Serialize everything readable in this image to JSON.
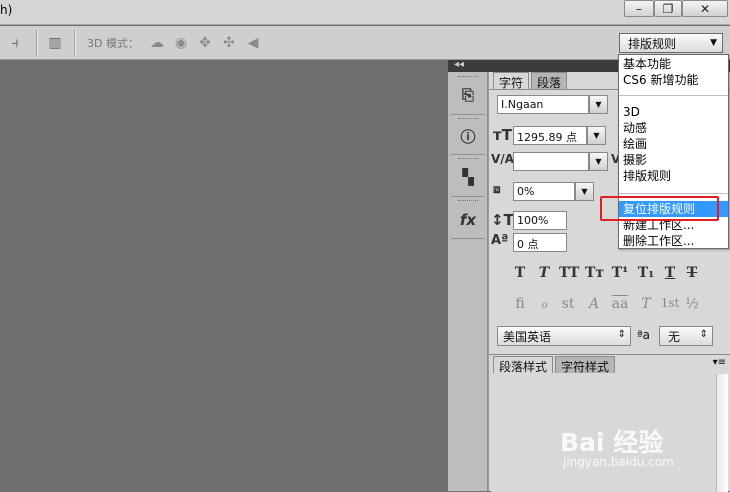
{
  "topbar": {
    "menu_fragment": "h)"
  },
  "window_buttons": {
    "minimize": "–",
    "restore": "❐",
    "close": "✕"
  },
  "options_bar": {
    "mode_label": "3D 模式："
  },
  "workspace": {
    "selected": "排版规则",
    "menu": {
      "group1": [
        "基本功能",
        "CS6 新增功能"
      ],
      "group2": [
        "3D",
        "动感",
        "绘画",
        "摄影",
        "排版规则"
      ],
      "group3": [
        "复位排版规则",
        "新建工作区...",
        "删除工作区..."
      ],
      "highlighted": "复位排版规则"
    }
  },
  "character_panel": {
    "tabs": [
      "字符",
      "段落"
    ],
    "font_family": "I.Ngaan",
    "font_size": "1295.89 点",
    "tracking": "0%",
    "vertical_scale": "100%",
    "baseline_shift": "0 点",
    "language": "美国英语",
    "antialias_label": "ªa",
    "antialias": "无",
    "style_buttons": [
      "T",
      "T",
      "TT",
      "Tт",
      "T¹",
      "T₁",
      "T",
      "T"
    ],
    "opentype_buttons": [
      "fi",
      "ℴ",
      "st",
      "A",
      "aa",
      "T",
      "1st",
      "½"
    ]
  },
  "bottom_panel": {
    "tabs": [
      "段落样式",
      "字符样式"
    ]
  },
  "watermark": {
    "brand": "Bai 经验",
    "url": "jingyan.baidu.com"
  },
  "colors": {
    "highlight": "#3399ff",
    "annotation_box": "#e02020",
    "canvas": "#707070"
  }
}
